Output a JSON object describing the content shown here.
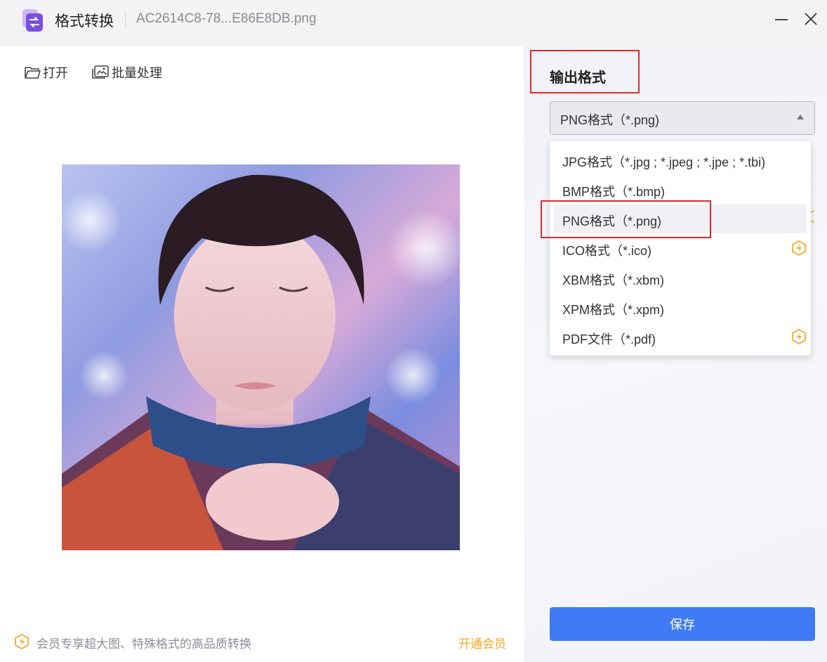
{
  "window": {
    "app_title": "格式转换",
    "file_name": "AC2614C8-78...E86E8DB.png",
    "icons": {
      "app": "app-convert-icon",
      "minimize": "minimize-icon",
      "close": "close-icon"
    }
  },
  "toolbar": {
    "open_label": "打开",
    "batch_label": "批量处理"
  },
  "footer": {
    "vip_tip": "会员专享超大图、特殊格式的高品质转换",
    "vip_link": "开通会员"
  },
  "output": {
    "label": "输出格式",
    "selected": "PNG格式（*.png)",
    "options": [
      {
        "label": "JPG格式（*.jpg ; *.jpeg ; *.jpe ; *.tbi)",
        "vip": false
      },
      {
        "label": "BMP格式（*.bmp)",
        "vip": false
      },
      {
        "label": "PNG格式（*.png)",
        "vip": false,
        "selected": true
      },
      {
        "label": "ICO格式（*.ico)",
        "vip": true
      },
      {
        "label": "XBM格式（*.xbm)",
        "vip": false
      },
      {
        "label": "XPM格式（*.xpm)",
        "vip": false
      },
      {
        "label": "PDF文件（*.pdf)",
        "vip": true
      }
    ],
    "save_label": "保存"
  },
  "colors": {
    "accent": "#3e7bf4",
    "vip": "#f5a623",
    "annotation": "#e02a2a"
  }
}
